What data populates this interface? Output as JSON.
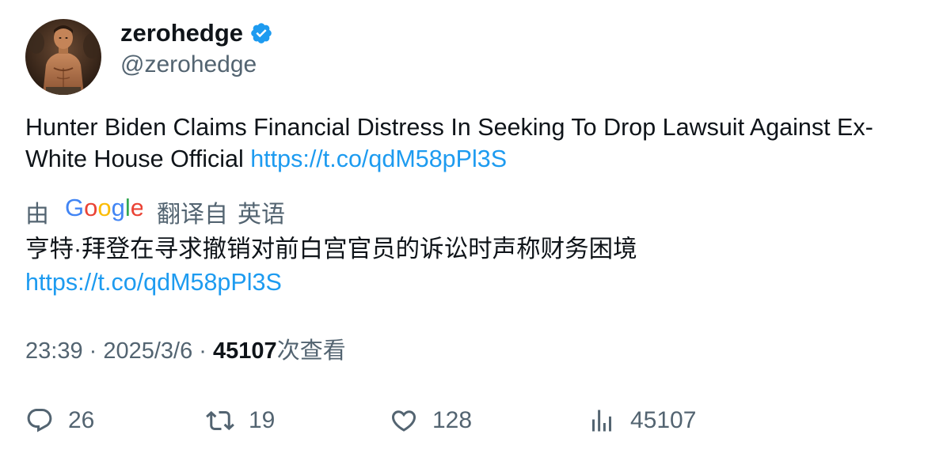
{
  "author": {
    "display_name": "zerohedge",
    "handle": "@zerohedge",
    "verified": true,
    "avatar_alt": "avatar"
  },
  "tweet": {
    "text": "Hunter Biden Claims Financial Distress In Seeking To Drop Lawsuit Against Ex-White House Official ",
    "link": "https://t.co/qdM58pPl3S"
  },
  "translation": {
    "prefix": "由",
    "provider": "Google",
    "suffix_1": "翻译自",
    "suffix_2": "英语",
    "text": "亨特·拜登在寻求撤销对前白宫官员的诉讼时声称财务困境",
    "link": "https://t.co/qdM58pPl3S"
  },
  "meta": {
    "time": "23:39",
    "sep1": " · ",
    "date": "2025/3/6",
    "sep2": " · ",
    "views_count": "45107",
    "views_label": "次查看"
  },
  "actions": {
    "replies": "26",
    "retweets": "19",
    "likes": "128",
    "views": "45107"
  },
  "colors": {
    "link": "#1d9bf0",
    "verified": "#1d9bf0",
    "secondary_text": "#536471",
    "primary_text": "#0f1419"
  },
  "icons": {
    "verified": "verified-badge-icon",
    "reply": "reply-icon",
    "retweet": "retweet-icon",
    "like": "heart-icon",
    "views": "analytics-icon",
    "google": "google-logo"
  }
}
